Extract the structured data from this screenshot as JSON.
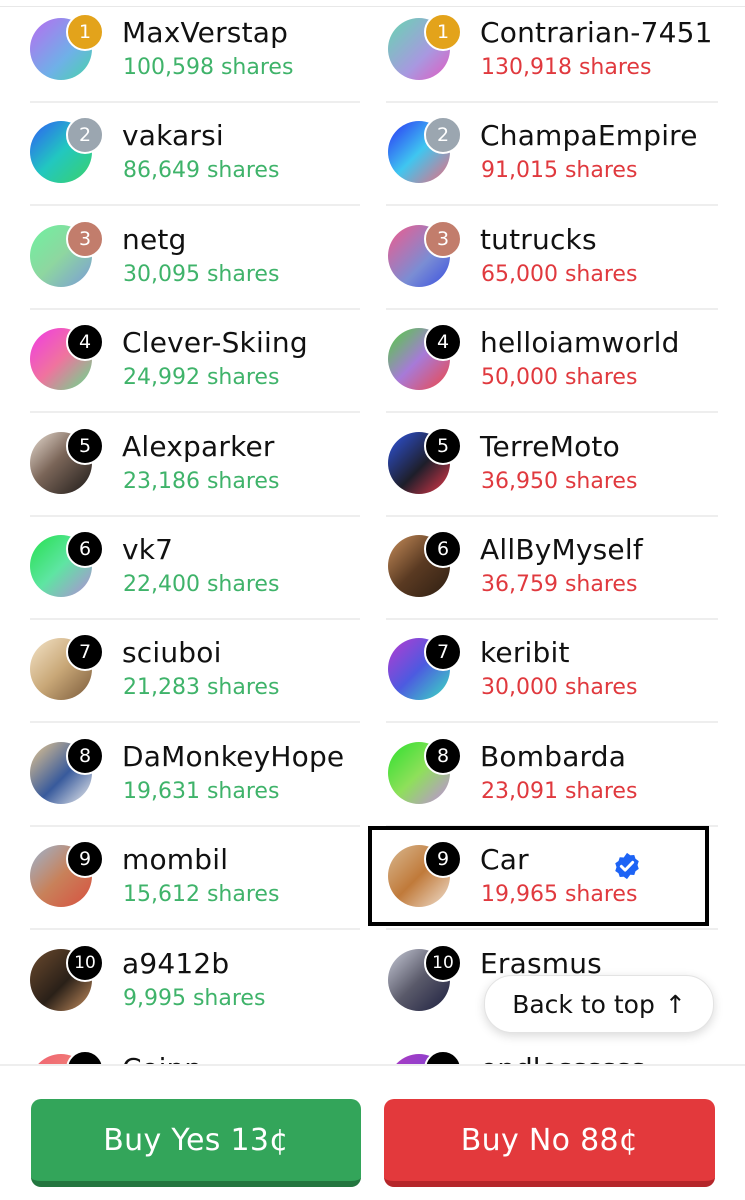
{
  "yes_holders": [
    {
      "rank": "1",
      "name": "MaxVerstap",
      "shares": "100,598 shares",
      "avatar": "linear-gradient(135deg,#b86cf0,#6fb0e8 60%,#48d4a8)"
    },
    {
      "rank": "2",
      "name": "vakarsi",
      "shares": "86,649 shares",
      "avatar": "linear-gradient(135deg,#2e5cf5,#22c7c0 50%,#3ad16a)"
    },
    {
      "rank": "3",
      "name": "netg",
      "shares": "30,095 shares",
      "avatar": "linear-gradient(135deg,#6ef2a0,#8ed6a0 50%,#7a9bd8)"
    },
    {
      "rank": "4",
      "name": "Clever-Skiing",
      "shares": "24,992 shares",
      "avatar": "linear-gradient(135deg,#f03ae6,#f0739e 50%,#61e08c)"
    },
    {
      "rank": "5",
      "name": "Alexparker",
      "shares": "23,186 shares",
      "avatar": "linear-gradient(135deg,#e9ddd2,#7a6558 45%,#1e1a18)"
    },
    {
      "rank": "6",
      "name": "vk7",
      "shares": "22,400 shares",
      "avatar": "linear-gradient(135deg,#25e04e,#5ee5a2 50%,#b38ad8)"
    },
    {
      "rank": "7",
      "name": "sciuboi",
      "shares": "21,283 shares",
      "avatar": "linear-gradient(135deg,#f4e4c8,#c9a878 50%,#7a5a3a)"
    },
    {
      "rank": "8",
      "name": "DaMonkeyHope",
      "shares": "19,631 shares",
      "avatar": "linear-gradient(135deg,#e8c890,#385a9c 55%,#f0f0f0)"
    },
    {
      "rank": "9",
      "name": "mombil",
      "shares": "15,612 shares",
      "avatar": "linear-gradient(135deg,#9cb4cf,#c8815a 50%,#d85040)"
    },
    {
      "rank": "10",
      "name": "a9412b",
      "shares": "9,995 shares",
      "avatar": "linear-gradient(135deg,#6b4a2e,#2a2018 55%,#c89060)"
    }
  ],
  "no_holders": [
    {
      "rank": "1",
      "name": "Contrarian-7451",
      "shares": "130,918 shares",
      "avatar": "linear-gradient(135deg,#66d6b0,#a898e0 60%,#e35ac0)"
    },
    {
      "rank": "2",
      "name": "ChampaEmpire",
      "shares": "91,015 shares",
      "avatar": "linear-gradient(135deg,#2a2ff5,#3fc6f0 50%,#f0697c)"
    },
    {
      "rank": "3",
      "name": "tutrucks",
      "shares": "65,000 shares",
      "avatar": "linear-gradient(135deg,#f25a8c,#7a8dd4 60%,#3a4fe0)"
    },
    {
      "rank": "4",
      "name": "helloiamworld",
      "shares": "50,000 shares",
      "avatar": "linear-gradient(135deg,#4fd23a,#a77ad8 50%,#f04646)"
    },
    {
      "rank": "5",
      "name": "TerreMoto",
      "shares": "36,950 shares",
      "avatar": "linear-gradient(135deg,#2f55e0,#1e1e2a 55%,#e8384a)"
    },
    {
      "rank": "6",
      "name": "AllByMyself",
      "shares": "36,759 shares",
      "avatar": "linear-gradient(135deg,#c78d5a,#5a3a22 50%,#2e1e12)"
    },
    {
      "rank": "7",
      "name": "keribit",
      "shares": "30,000 shares",
      "avatar": "linear-gradient(135deg,#b83ad0,#4d5ae0 50%,#3ae0c0)"
    },
    {
      "rank": "8",
      "name": "Bombarda",
      "shares": "23,091 shares",
      "avatar": "linear-gradient(135deg,#2de02e,#8ee05a 50%,#c28ae0)"
    },
    {
      "rank": "9",
      "name": "Car",
      "shares": "19,965 shares",
      "avatar": "linear-gradient(135deg,#d8b890,#c07a3a 50%,#f0e0d0)",
      "verified": true
    },
    {
      "rank": "10",
      "name": "Erasmus",
      "shares": "",
      "avatar": "linear-gradient(135deg,#c8cbd8,#5a5a6a 50%,#1e2040)"
    }
  ],
  "partial_row_left": {
    "name": "Coinn"
  },
  "partial_row_right": {
    "name": "endlessssss"
  },
  "back_to_top": {
    "label": "Back to top",
    "arrow": "↑"
  },
  "buy_yes": {
    "label": "Buy Yes 13¢"
  },
  "buy_no": {
    "label": "Buy No 88¢"
  },
  "colors": {
    "yes": "#3fb36a",
    "no": "#e0393e",
    "verified": "#1d63f5"
  }
}
